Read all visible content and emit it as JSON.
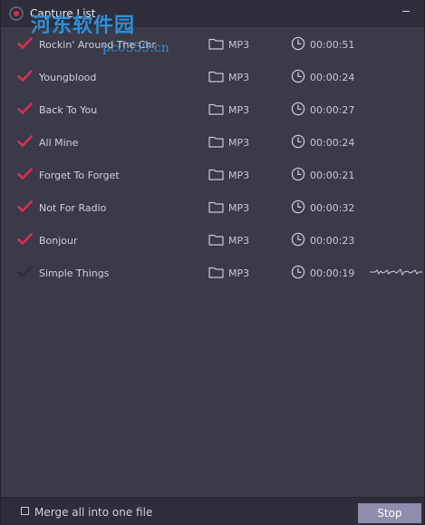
{
  "window": {
    "title": "Capture List"
  },
  "watermark": {
    "cn": "河东软件园",
    "url": "pc0359.cn"
  },
  "colors": {
    "check_active": "#d7314f",
    "check_inactive": "#2f2f3b",
    "accent_button": "#8e8dac",
    "watermark_blue": "#2f8fd8"
  },
  "tracks": [
    {
      "title": "Rockin' Around The Chris",
      "format": "MP3",
      "duration": "00:00:51",
      "checked": true
    },
    {
      "title": "Youngblood",
      "format": "MP3",
      "duration": "00:00:24",
      "checked": true
    },
    {
      "title": "Back To You",
      "format": "MP3",
      "duration": "00:00:27",
      "checked": true
    },
    {
      "title": "All Mine",
      "format": "MP3",
      "duration": "00:00:24",
      "checked": true
    },
    {
      "title": "Forget To Forget",
      "format": "MP3",
      "duration": "00:00:21",
      "checked": true
    },
    {
      "title": "Not For Radio",
      "format": "MP3",
      "duration": "00:00:32",
      "checked": true
    },
    {
      "title": "Bonjour",
      "format": "MP3",
      "duration": "00:00:23",
      "checked": true
    },
    {
      "title": "Simple Things",
      "format": "MP3",
      "duration": "00:00:19",
      "checked": false,
      "recording": true
    }
  ],
  "footer": {
    "merge_label": "Merge all into one file",
    "merge_checked": false,
    "stop_label": "Stop"
  },
  "icons": {
    "check": "check-icon",
    "folder": "folder-icon",
    "clock": "clock-icon",
    "wave": "waveform-icon"
  }
}
